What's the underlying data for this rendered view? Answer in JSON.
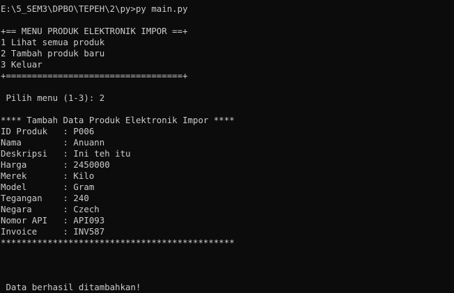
{
  "terminal": {
    "background": "#0c0c0c",
    "foreground": "#cccccc",
    "prompt_line": "E:\\5_SEM3\\DPBO\\TEPEH\\2\\py>py main.py",
    "menu": {
      "top_border": "+== MENU PRODUK ELEKTRONIK IMPOR ==+",
      "items": [
        "1 Lihat semua produk",
        "2 Tambah produk baru",
        "3 Keluar"
      ],
      "bottom_border": "+==================================+"
    },
    "choice_line": " Pilih menu (1-3): 2",
    "form": {
      "header": "**** Tambah Data Produk Elektronik Impor ****",
      "fields": [
        "ID Produk   : P006",
        "Nama        : Anuann",
        "Deskripsi   : Ini teh itu",
        "Harga       : 2450000",
        "Merek       : Kilo",
        "Model       : Gram",
        "Tegangan    : 240",
        "Negara      : Czech",
        "Nomor API   : API093",
        "Invoice     : INV587"
      ],
      "footer": "*********************************************"
    },
    "result": " Data berhasil ditambahkan!"
  }
}
